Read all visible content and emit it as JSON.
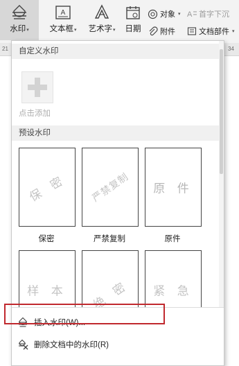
{
  "ribbon": {
    "watermark": {
      "label": "水印",
      "caret": "▾"
    },
    "textbox": {
      "label": "文本框",
      "caret": "▾"
    },
    "wordart": {
      "label": "艺术字",
      "caret": "▾"
    },
    "date": {
      "label": "日期"
    },
    "object": {
      "label": "对象",
      "caret": "▾"
    },
    "attachment": {
      "label": "附件"
    },
    "dropcap": {
      "label": "首字下沉"
    },
    "docparts": {
      "label": "文档部件",
      "caret": "▾"
    }
  },
  "ruler": {
    "left_num": "21",
    "right_num": "34"
  },
  "dropdown": {
    "custom_header": "自定义水印",
    "add_label": "点击添加",
    "preset_header": "预设水印",
    "presets": [
      {
        "mark": "保 密",
        "label": "保密"
      },
      {
        "mark": "严禁复制",
        "label": "严禁复制"
      },
      {
        "mark": "原 件",
        "label": "原件"
      },
      {
        "mark": "样 本",
        "label": ""
      },
      {
        "mark": "绝 密",
        "label": ""
      },
      {
        "mark": "紧 急",
        "label": ""
      }
    ],
    "menu": {
      "insert": "插入水印(W)...",
      "delete": "删除文档中的水印(R)"
    }
  },
  "colors": {
    "highlight": "#c0282d",
    "accent": "#2b579a"
  }
}
